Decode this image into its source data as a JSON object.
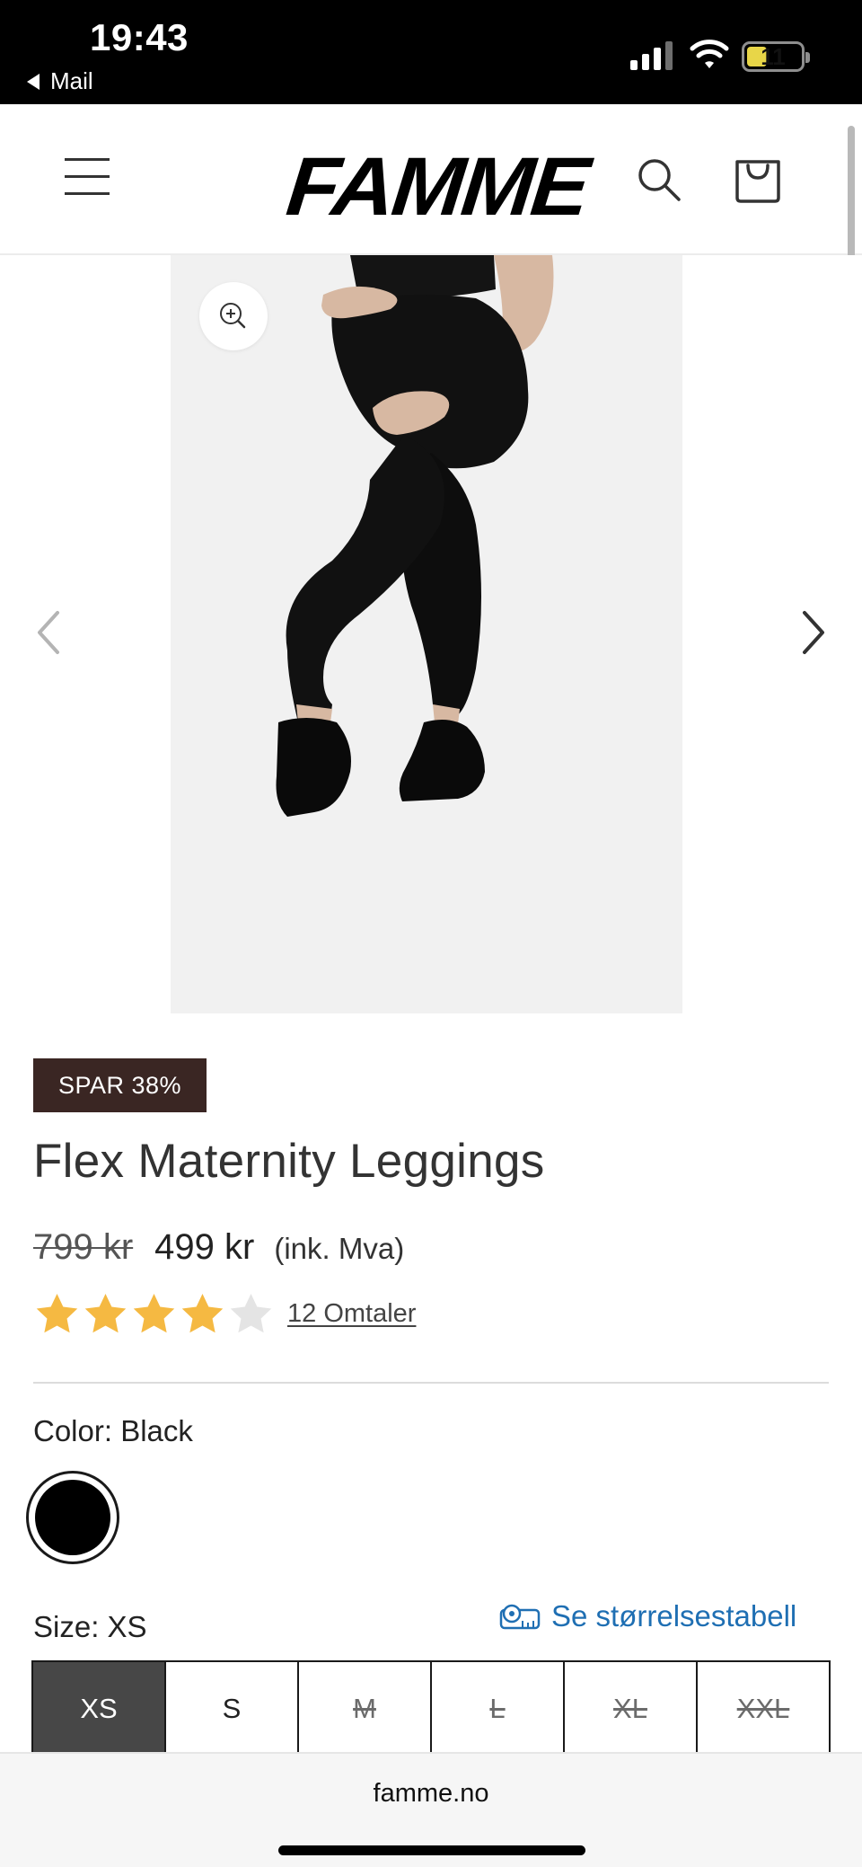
{
  "status_bar": {
    "time": "19:43",
    "back_app": "Mail",
    "battery": "11"
  },
  "header": {
    "logo": "FAMME",
    "icons": {
      "menu": "hamburger-icon",
      "search": "search-icon",
      "cart": "shopping-bag-icon"
    }
  },
  "gallery": {
    "zoom_icon": "zoom-in-icon",
    "prev_icon": "chevron-left-icon",
    "next_icon": "chevron-right-icon"
  },
  "product": {
    "badge": "SPAR 38%",
    "title": "Flex Maternity Leggings",
    "old_price": "799 kr",
    "price": "499 kr",
    "tax_note": "(ink. Mva)",
    "rating": 4,
    "rating_max": 5,
    "reviews": "12 Omtaler",
    "color_label": "Color: Black",
    "color_value": "#000000",
    "size_label": "Size: XS",
    "size_chart": "Se størrelsestabell",
    "sizes": [
      {
        "label": "XS",
        "state": "selected"
      },
      {
        "label": "S",
        "state": "available"
      },
      {
        "label": "M",
        "state": "soldout"
      },
      {
        "label": "L",
        "state": "soldout"
      },
      {
        "label": "XL",
        "state": "soldout"
      },
      {
        "label": "XXL",
        "state": "soldout"
      }
    ]
  },
  "browser": {
    "url": "famme.no"
  },
  "colors": {
    "badge_bg": "#3a2623",
    "star_filled": "#f5b942",
    "star_empty": "#e4e4e4",
    "link": "#1f6fb3",
    "selected_size_bg": "#474747"
  }
}
